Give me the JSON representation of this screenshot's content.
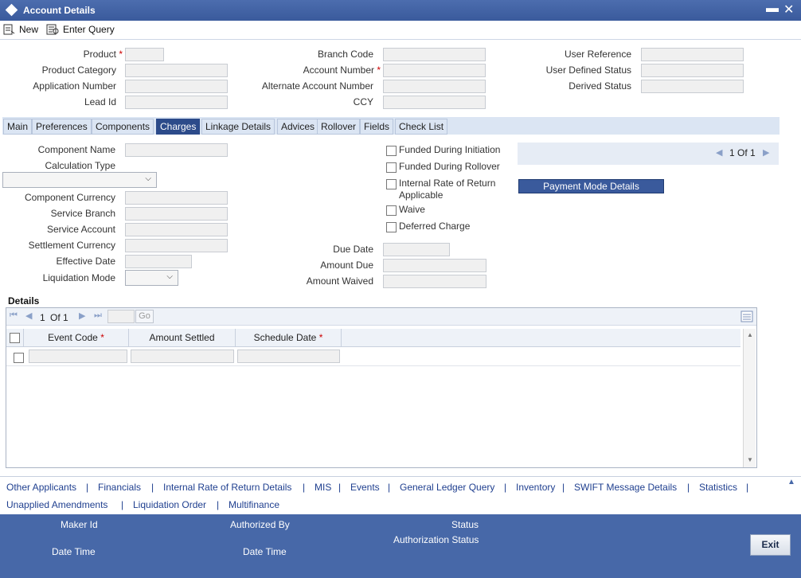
{
  "window": {
    "title": "Account Details",
    "minimize": "▬",
    "close": "✕"
  },
  "toolbar": {
    "new_label": "New",
    "enter_query_label": "Enter Query"
  },
  "header": {
    "product_label": "Product",
    "product_category_label": "Product Category",
    "application_number_label": "Application Number",
    "lead_id_label": "Lead Id",
    "branch_code_label": "Branch Code",
    "account_number_label": "Account Number",
    "alternate_account_number_label": "Alternate Account Number",
    "ccy_label": "CCY",
    "user_reference_label": "User Reference",
    "user_defined_status_label": "User Defined Status",
    "derived_status_label": "Derived Status",
    "required_mark": "*"
  },
  "tabs": [
    {
      "label": "Main"
    },
    {
      "label": "Preferences"
    },
    {
      "label": "Components"
    },
    {
      "label": "Charges",
      "active": true
    },
    {
      "label": "Linkage Details"
    },
    {
      "label": "Advices"
    },
    {
      "label": "Rollover"
    },
    {
      "label": "Fields"
    },
    {
      "label": "Check List"
    }
  ],
  "charges": {
    "component_name_label": "Component Name",
    "calculation_type_label": "Calculation Type",
    "component_currency_label": "Component Currency",
    "service_branch_label": "Service Branch",
    "service_account_label": "Service Account",
    "settlement_currency_label": "Settlement Currency",
    "effective_date_label": "Effective Date",
    "liquidation_mode_label": "Liquidation Mode",
    "due_date_label": "Due Date",
    "amount_due_label": "Amount Due",
    "amount_waived_label": "Amount Waived",
    "funded_initiation_label": "Funded During Initiation",
    "funded_rollover_label": "Funded During Rollover",
    "irr_line1": "Internal Rate of Return",
    "irr_line2": "Applicable",
    "waive_label": "Waive",
    "deferred_charge_label": "Deferred Charge",
    "pager": "1 Of 1",
    "payment_mode_button": "Payment Mode Details"
  },
  "details": {
    "section_title": "Details",
    "pager_current": "1",
    "pager_of": "Of 1",
    "go_label": "Go",
    "columns": [
      "Event Code",
      "Amount Settled",
      "Schedule Date"
    ],
    "required_mark": "*"
  },
  "links": {
    "row1": [
      "Other Applicants",
      "Financials",
      "Internal Rate of Return Details",
      "MIS",
      "Events",
      "General Ledger Query",
      "Inventory",
      "SWIFT Message Details",
      "Statistics"
    ],
    "row2": [
      "Unapplied Amendments",
      "Liquidation Order",
      "Multifinance"
    ],
    "separator": "|"
  },
  "footer": {
    "maker_id_label": "Maker Id",
    "date_time_label_1": "Date Time",
    "authorized_by_label": "Authorized By",
    "date_time_label_2": "Date Time",
    "status_label": "Status",
    "authorization_status_label": "Authorization Status",
    "exit_label": "Exit"
  }
}
